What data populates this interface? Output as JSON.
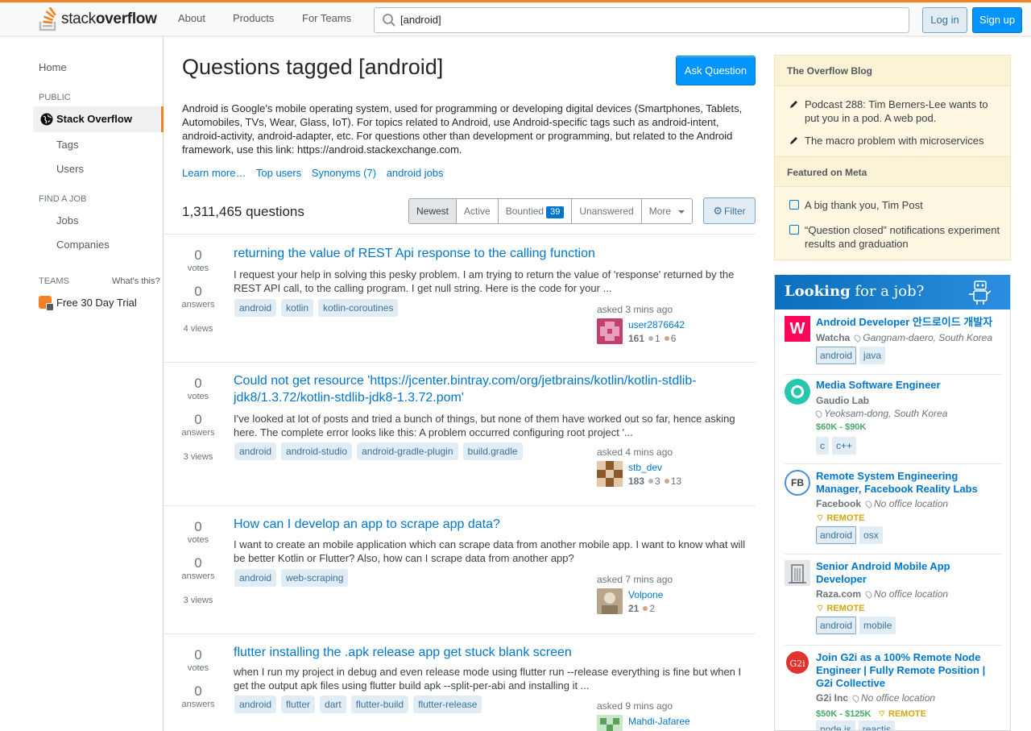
{
  "header": {
    "logo_light": "stack",
    "logo_bold": "overflow",
    "nav": [
      "About",
      "Products",
      "For Teams"
    ],
    "search_value": "[android]",
    "login_label": "Log in",
    "signup_label": "Sign up"
  },
  "sidebar": {
    "home": "Home",
    "public_heading": "PUBLIC",
    "stack_overflow": "Stack Overflow",
    "tags": "Tags",
    "users": "Users",
    "find_job_heading": "FIND A JOB",
    "jobs": "Jobs",
    "companies": "Companies",
    "teams_heading": "TEAMS",
    "whats_this": "What's this?",
    "free_trial": "Free 30 Day Trial"
  },
  "main": {
    "title": "Questions tagged [android]",
    "ask_button": "Ask Question",
    "description": "Android is Google's mobile operating system, used for programming or developing digital devices (Smartphones, Tablets, Automobiles, TVs, Wear, Glass, IoT). For topics related to Android, use Android-specific tags such as android-intent, android-activity, android-adapter, etc. For questions other than development or programming, but related to the Android framework, use this link: https://android.stackexchange.com.",
    "links": [
      "Learn more…",
      "Top users",
      "Synonyms (7)",
      "android jobs"
    ],
    "question_count": "1,311,465 questions",
    "tabs": {
      "newest": "Newest",
      "active": "Active",
      "bountied": "Bountied",
      "bountied_count": "39",
      "unanswered": "Unanswered",
      "more": "More"
    },
    "filter_label": "Filter"
  },
  "questions": [
    {
      "votes": "0",
      "votes_label": "votes",
      "answers": "0",
      "answers_label": "answers",
      "views": "4 views",
      "title": "returning the value of REST Api response to the calling function",
      "excerpt": "I request your help in solving this pesky problem. I am trying to return the value of 'response' returned by the REST API call, to the calling program. I get null string. Here is the code for your ...",
      "tags": [
        "android",
        "kotlin",
        "kotlin-coroutines"
      ],
      "asked": "asked 3 mins ago",
      "user": "user2876642",
      "rep": "161",
      "silver": "1",
      "bronze": "6",
      "avatar_color": "#c2406e"
    },
    {
      "votes": "0",
      "votes_label": "votes",
      "answers": "0",
      "answers_label": "answers",
      "views": "3 views",
      "title": "Could not get resource 'https://jcenter.bintray.com/org/jetbrains/kotlin/kotlin-stdlib-jdk8/1.3.72/kotlin-stdlib-jdk8-1.3.72.pom'",
      "excerpt": "I've looked at lot of posts and tried a bunch of things, but none of them have worked out so far, hence asking here. The complete error looks like this: A problem occurred configuring root project '...",
      "tags": [
        "android",
        "android-studio",
        "android-gradle-plugin",
        "build.gradle"
      ],
      "asked": "asked 4 mins ago",
      "user": "stb_dev",
      "rep": "183",
      "silver": "3",
      "bronze": "13",
      "avatar_color": "#8a5a2b"
    },
    {
      "votes": "0",
      "votes_label": "votes",
      "answers": "0",
      "answers_label": "answers",
      "views": "3 views",
      "title": "How can I develop an app to scrape app data?",
      "excerpt": "I want to create an mobile application which can scrape data from another mobile app. I want to know what will be better Kotlin or Flutter? Also, how can I scrape data from another app?",
      "tags": [
        "android",
        "web-scraping"
      ],
      "asked": "asked 7 mins ago",
      "user": "Volpone",
      "rep": "21",
      "bronze": "2",
      "avatar_color": "#b8a58a"
    },
    {
      "votes": "0",
      "votes_label": "votes",
      "answers": "0",
      "answers_label": "answers",
      "title": "flutter installing the .apk release app get stuck blank screen",
      "excerpt": "when I run my project in debug and even release mode using flutter run --release everything is fine but when I get the output apk files using flutter build apk --split-per-abi and installing it ...",
      "tags": [
        "android",
        "flutter",
        "dart",
        "flutter-build",
        "flutter-release"
      ],
      "asked": "asked 9 mins ago",
      "user": "Mahdi-Jafaree",
      "avatar_color": "#5aa05a"
    }
  ],
  "blog": {
    "heading": "The Overflow Blog",
    "items": [
      "Podcast 288: Tim Berners-Lee wants to put you in a pod. A web pod.",
      "The macro problem with microservices"
    ],
    "meta_heading": "Featured on Meta",
    "meta_items": [
      "A big thank you, Tim Post",
      "“Question closed” notifications experiment results and graduation"
    ]
  },
  "jobs": {
    "heading_bold": "Looking",
    "heading_rest": " for a job?",
    "list": [
      {
        "title": "Android Developer 안드로이드 개발자",
        "company": "Watcha",
        "location": "Gangnam-daero, South Korea",
        "tags": [
          "android",
          "java"
        ],
        "logo_text": "W",
        "logo_color": "#ff0558"
      },
      {
        "title": "Media Software Engineer",
        "company": "Gaudio Lab",
        "location": "Yeoksam-dong, South Korea",
        "salary": "$60K - $90K",
        "tags": [
          "c",
          "c++"
        ],
        "logo_color": "#26c6b0"
      },
      {
        "title": "Remote System Engineering Manager, Facebook Reality Labs",
        "company": "Facebook",
        "location": "No office location",
        "remote": "REMOTE",
        "tags": [
          "android",
          "osx"
        ],
        "logo_text": "FB"
      },
      {
        "title": "Senior Android Mobile App Developer",
        "company": "Raza.com",
        "location": "No office location",
        "remote": "REMOTE",
        "tags": [
          "android",
          "mobile"
        ]
      },
      {
        "title": "Join G2i as a 100% Remote Node Engineer | Fully Remote Position | G2i Collective",
        "company": "G2i Inc",
        "location": "No office location",
        "salary": "$50K - $125K",
        "remote": "REMOTE",
        "tags": [
          "node.js",
          "reactjs"
        ],
        "logo_text": "G2i",
        "logo_color": "#e3312d"
      }
    ]
  }
}
